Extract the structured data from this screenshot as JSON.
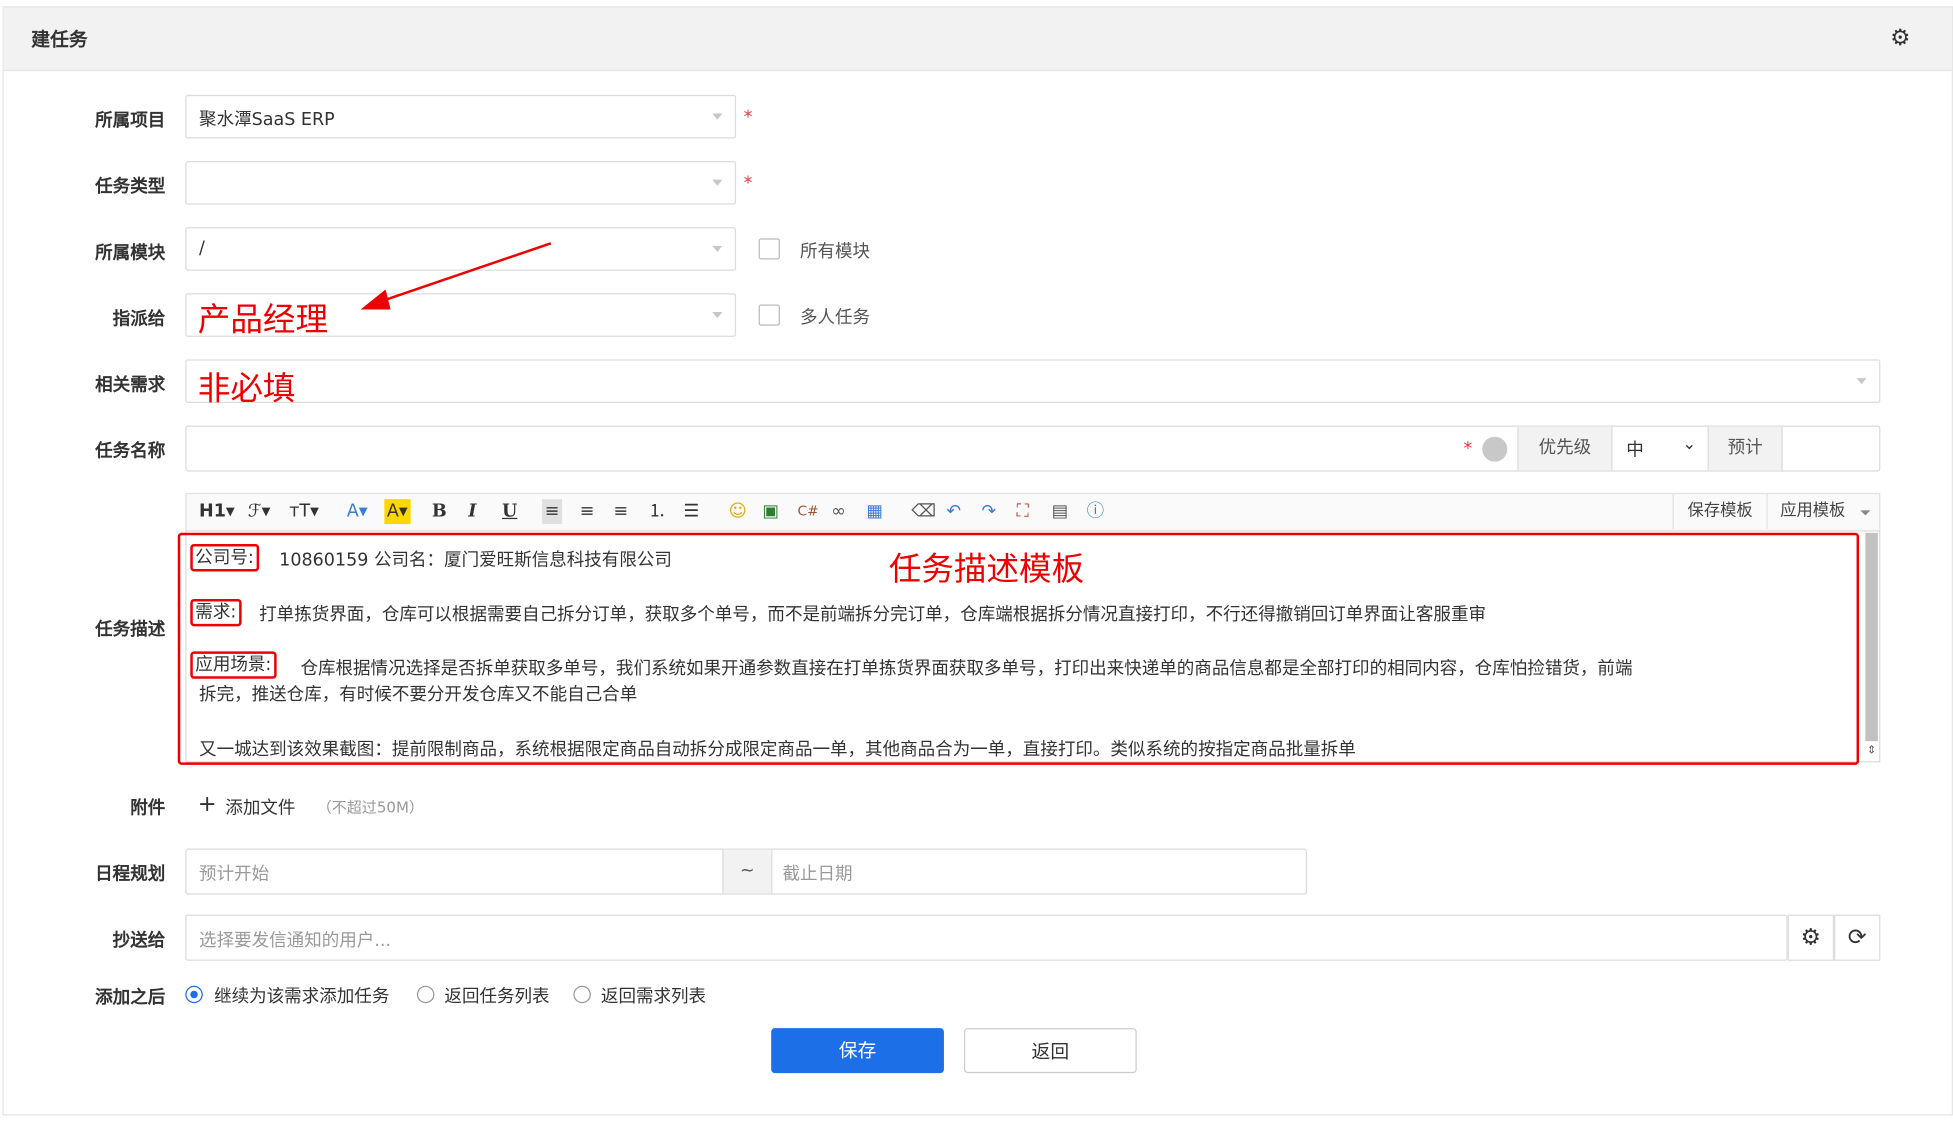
{
  "header": {
    "title": "建任务",
    "settings_icon": "gear-icon"
  },
  "form": {
    "project": {
      "label": "所属项目",
      "value": "聚水潭SaaS ERP",
      "required": "*"
    },
    "task_type": {
      "label": "任务类型",
      "value": "",
      "required": "*"
    },
    "module": {
      "label": "所属模块",
      "value": "/",
      "all_modules_label": "所有模块"
    },
    "assign": {
      "label": "指派给",
      "value": "",
      "multi_label": "多人任务"
    },
    "related_req": {
      "label": "相关需求",
      "value": ""
    },
    "task_name": {
      "label": "任务名称",
      "value": "",
      "required": "*",
      "priority_label": "优先级",
      "priority_value": "中",
      "estimate_label": "预计"
    },
    "description": {
      "label": "任务描述",
      "toolbar": {
        "save_template": "保存模板",
        "apply_template": "应用模板"
      },
      "tag_company": "公司号:",
      "line1_rest": "10860159 公司名：厦门爱旺斯信息科技有限公司",
      "tag_need": "需求:",
      "line2_rest": "打单拣货界面，仓库可以根据需要自己拆分订单，获取多个单号，而不是前端拆分完订单，仓库端根据拆分情况直接打印，不行还得撤销回订单界面让客服重审",
      "tag_scene": "应用场景:",
      "line3_rest": "仓库根据情况选择是否拆单获取多单号，我们系统如果开通参数直接在打单拣货界面获取多单号，打印出来快递单的商品信息都是全部打印的相同内容，仓库怕捡错货，前端",
      "line4": "拆完，推送仓库，有时候不要分开发仓库又不能自己合单",
      "line5": "又一城达到该效果截图：提前限制商品，系统根据限定商品自动拆分成限定商品一单，其他商品合为一单，直接打印。类似系统的按指定商品批量拆单"
    },
    "attachment": {
      "label": "附件",
      "add_label": "添加文件",
      "hint": "（不超过50M）"
    },
    "schedule": {
      "label": "日程规划",
      "start_placeholder": "预计开始",
      "separator": "~",
      "end_placeholder": "截止日期"
    },
    "cc": {
      "label": "抄送给",
      "placeholder": "选择要发信通知的用户..."
    },
    "after": {
      "label": "添加之后",
      "options": [
        "继续为该需求添加任务",
        "返回任务列表",
        "返回需求列表"
      ],
      "selected": 0
    }
  },
  "buttons": {
    "save": "保存",
    "back": "返回"
  },
  "annotations": {
    "assign_note": "产品经理",
    "related_note": "非必填",
    "template_note": "任务描述模板"
  },
  "colors": {
    "primary": "#1d6fe8",
    "annotation": "#ee0000"
  }
}
